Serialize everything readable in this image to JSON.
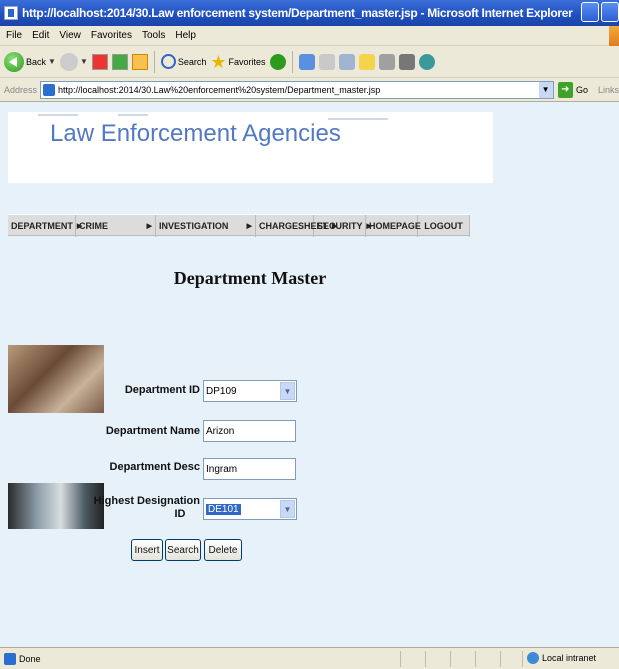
{
  "window": {
    "title": "http://localhost:2014/30.Law enforcement system/Department_master.jsp - Microsoft Internet Explorer"
  },
  "menu": [
    "File",
    "Edit",
    "View",
    "Favorites",
    "Tools",
    "Help"
  ],
  "toolbar": {
    "back_label": "Back",
    "search_label": "Search",
    "favorites_label": "Favorites"
  },
  "address": {
    "label": "Address",
    "url": "http://localhost:2014/30.Law%20enforcement%20system/Department_master.jsp",
    "go_label": "Go",
    "links_label": "Links"
  },
  "banner": {
    "title": "Law Enforcement Agencies"
  },
  "nav": [
    {
      "label": "DEPARTMENT",
      "arrow": true
    },
    {
      "label": "CRIME",
      "arrow": true
    },
    {
      "label": "INVESTIGATION",
      "arrow": true
    },
    {
      "label": "CHARGESHEET",
      "arrow": true
    },
    {
      "label": "SECURITY",
      "arrow": true
    },
    {
      "label": "HOMEPAGE",
      "arrow": false
    },
    {
      "label": "LOGOUT",
      "arrow": false
    }
  ],
  "page": {
    "title": "Department Master"
  },
  "form": {
    "dept_id_label": "Department ID",
    "dept_id_value": "DP109",
    "dept_name_label": "Department Name",
    "dept_name_value": "Arizon",
    "dept_desc_label": "Department Desc",
    "dept_desc_value": "Ingram",
    "highest_desig_label_line1": "Highest Designation",
    "highest_desig_label_line2": "ID",
    "highest_desig_value": "DE101",
    "insert_label": "Insert",
    "search_label": "Search",
    "delete_label": "Delete"
  },
  "status": {
    "text": "Done",
    "zone": "Local intranet"
  }
}
